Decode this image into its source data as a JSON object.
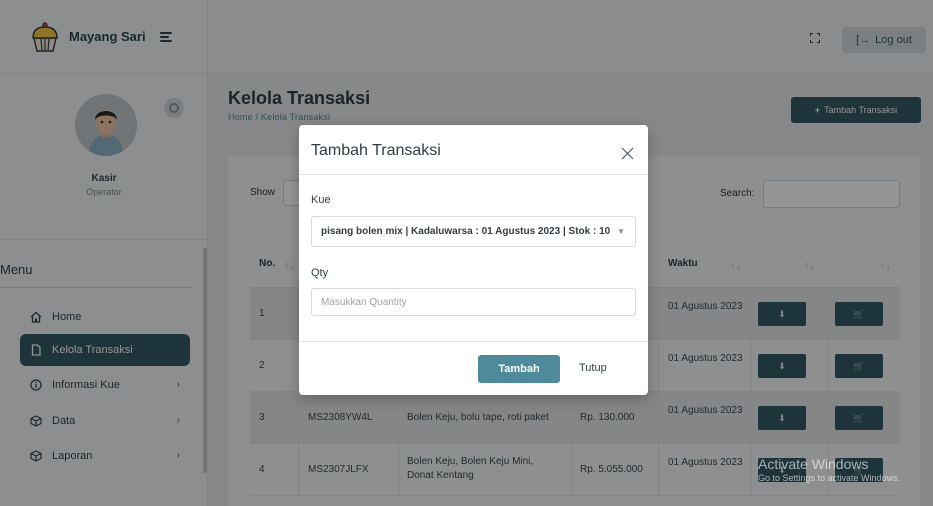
{
  "app": {
    "brand_name": "Mayang Sari",
    "logout_label": "Log out"
  },
  "profile": {
    "name": "Kasir",
    "role": "Operator"
  },
  "menu": {
    "title": "Menu",
    "items": [
      {
        "label": "Home",
        "icon": "home-icon"
      },
      {
        "label": "Kelola Transaksi",
        "icon": "file-icon",
        "active": true
      },
      {
        "label": "Informasi Kue",
        "icon": "info-icon",
        "chevron": "›"
      },
      {
        "label": "Data",
        "icon": "cube-icon",
        "chevron": "›"
      },
      {
        "label": "Laporan",
        "icon": "cube-icon",
        "chevron": "›"
      }
    ]
  },
  "page": {
    "title": "Kelola Transaksi",
    "breadcrumb": "Home / Kelola Transaksi",
    "add_button": "Tambah Transaksi",
    "add_button_icon": "+"
  },
  "table_controls": {
    "show_label": "Show",
    "search_label": "Search:"
  },
  "table": {
    "headers": [
      "No.",
      "Waktu"
    ],
    "sort_glyph": "↑↓",
    "rows": [
      {
        "no": "1",
        "id": "",
        "items": "",
        "total": "",
        "waktu": "01 Agustus 2023"
      },
      {
        "no": "2",
        "id": "",
        "items": "",
        "total": "",
        "waktu": "01 Agustus 2023"
      },
      {
        "no": "3",
        "id": "MS2308YW4L",
        "items": "Bolen Keju, bolu tape, roti paket",
        "total": "Rp. 130.000",
        "waktu": "01 Agustus 2023"
      },
      {
        "no": "4",
        "id": "MS2307JLFX",
        "items": "Bolen Keju, Bolen Keju Mini, Donat Kentang",
        "total": "Rp. 5.055.000",
        "waktu": "01 Agustus 2023"
      }
    ],
    "action_icons": [
      "download-icon",
      "cart-icon"
    ]
  },
  "modal": {
    "title": "Tambah Transaksi",
    "kue_label": "Kue",
    "kue_value": "pisang bolen mix | Kadaluwarsa : 01 Agustus 2023 | Stok : 10",
    "qty_label": "Qty",
    "qty_placeholder": "Masukkan Quantity",
    "submit_label": "Tambah",
    "close_label": "Tutup"
  },
  "watermark": {
    "title": "Activate Windows",
    "subtitle": "Go to Settings to activate Windows."
  },
  "colors": {
    "primary": "#345a66",
    "button_primary": "#4d8a9b",
    "breadcrumb": "#4a8c9c"
  }
}
